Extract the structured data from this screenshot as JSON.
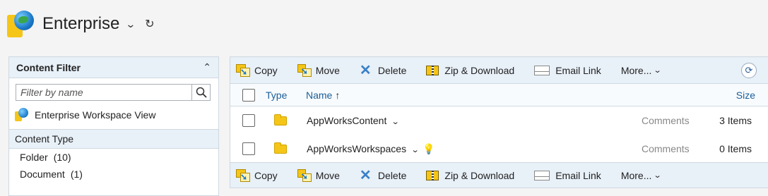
{
  "header": {
    "title": "Enterprise",
    "chevron": "⌄",
    "refresh": "↻"
  },
  "filter": {
    "title": "Content Filter",
    "search_placeholder": "Filter by name",
    "workspace_view": "Enterprise Workspace View",
    "content_type_label": "Content Type",
    "content_types": [
      {
        "label": "Folder",
        "count": "(10)"
      },
      {
        "label": "Document",
        "count": "(1)"
      }
    ]
  },
  "toolbar": {
    "copy": "Copy",
    "move": "Move",
    "delete": "Delete",
    "zip": "Zip & Download",
    "email": "Email Link",
    "more": "More..."
  },
  "columns": {
    "type": "Type",
    "name": "Name",
    "size": "Size"
  },
  "rows": [
    {
      "name": "AppWorksContent",
      "comments": "Comments",
      "size": "3 Items"
    },
    {
      "name": "AppWorksWorkspaces",
      "comments": "Comments",
      "size": "0 Items"
    }
  ],
  "colors": {
    "panel_head": "#e8f0f8",
    "link": "#1a5e9a",
    "folder": "#f5c518"
  },
  "icons": [
    "enterprise-logo-icon",
    "chevron-down-icon",
    "refresh-icon",
    "chevron-up-icon",
    "search-icon",
    "copy-icon",
    "move-icon",
    "delete-icon",
    "zip-icon",
    "email-icon",
    "folder-icon",
    "lightbulb-icon"
  ]
}
